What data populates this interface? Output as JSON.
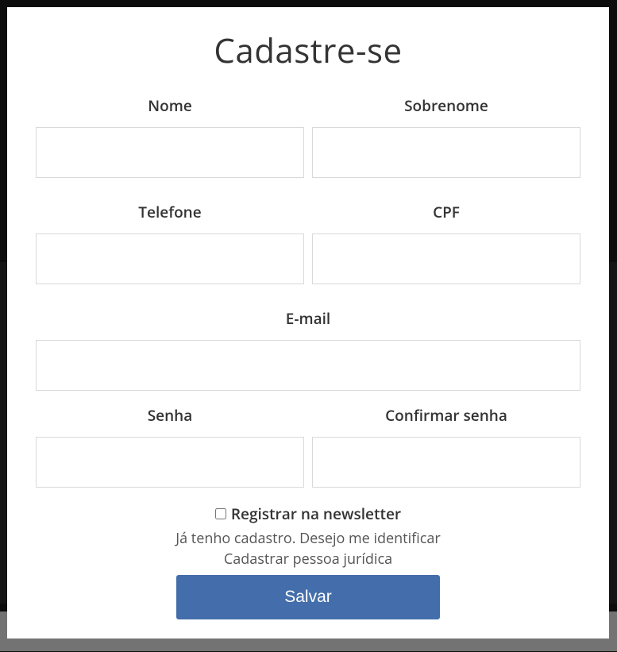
{
  "modal": {
    "title": "Cadastre-se",
    "fields": {
      "first_name_label": "Nome",
      "last_name_label": "Sobrenome",
      "phone_label": "Telefone",
      "cpf_label": "CPF",
      "email_label": "E-mail",
      "password_label": "Senha",
      "confirm_password_label": "Confirmar senha"
    },
    "newsletter_label": "Registrar na newsletter",
    "login_link": "Já tenho cadastro. Desejo me identificar",
    "company_link": "Cadastrar pessoa jurídica",
    "submit_label": "Salvar"
  }
}
